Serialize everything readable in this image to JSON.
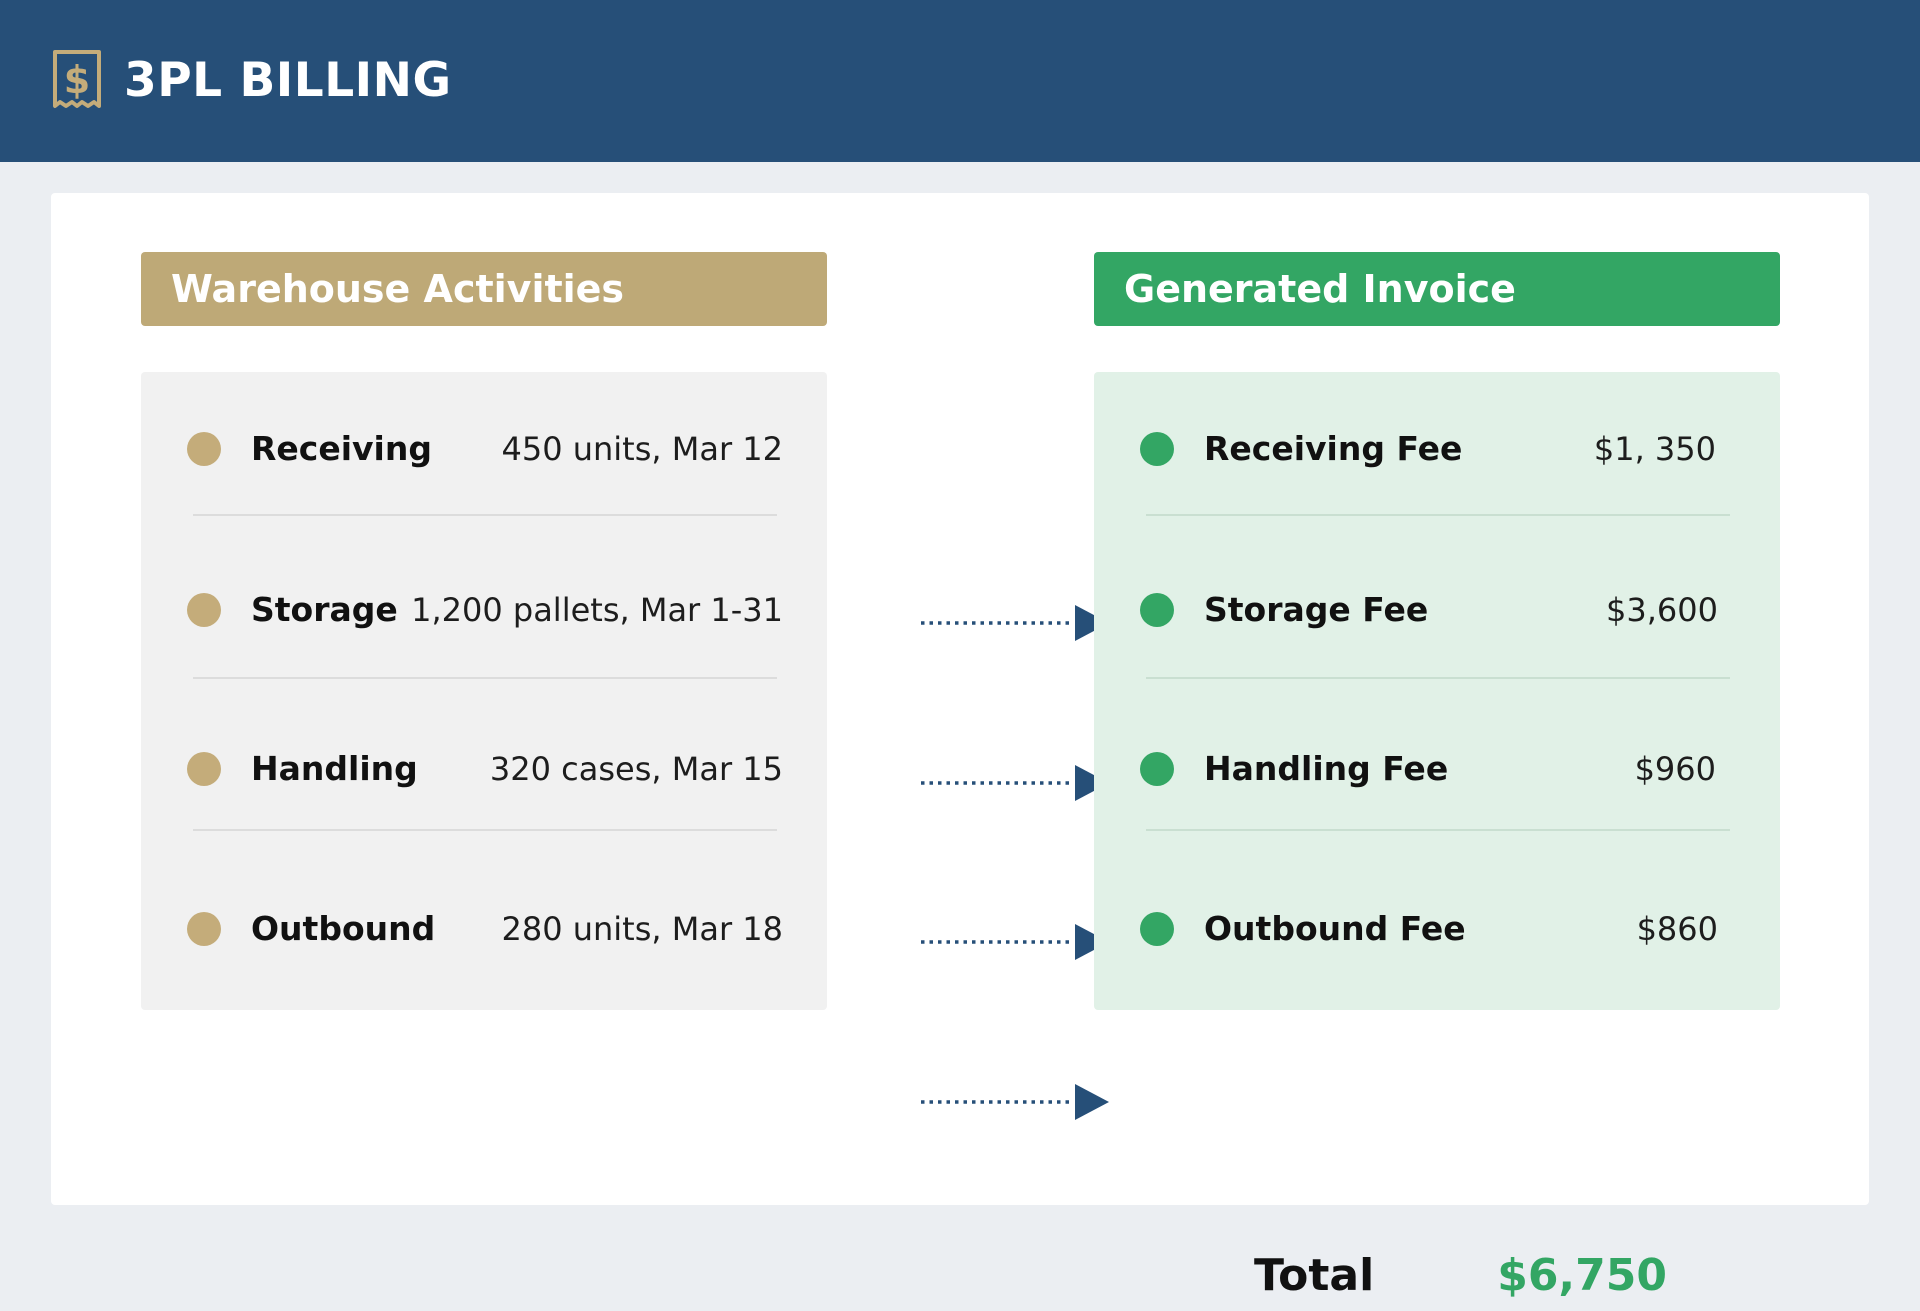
{
  "app": {
    "title": "3PL BILLING",
    "logo_icon": "receipt-dollar-icon"
  },
  "activities": {
    "title": "Warehouse Activities",
    "items": [
      {
        "label": "Receiving",
        "detail": "450 units, Mar 12"
      },
      {
        "label": "Storage",
        "detail": "1,200 pallets, Mar 1-31"
      },
      {
        "label": "Handling",
        "detail": "320 cases, Mar 15"
      },
      {
        "label": "Outbound",
        "detail": "280 units, Mar 18"
      }
    ]
  },
  "invoice": {
    "title": "Generated Invoice",
    "items": [
      {
        "label": "Receiving Fee",
        "amount": "$1, 350"
      },
      {
        "label": "Storage Fee",
        "amount": "$3,600"
      },
      {
        "label": "Handling Fee",
        "amount": "$960"
      },
      {
        "label": "Outbound Fee",
        "amount": "$860"
      }
    ],
    "total_label": "Total",
    "total_value": "$6,750"
  },
  "colors": {
    "header": "#264f78",
    "gold": "#bea977",
    "green": "#33a664",
    "arrow": "#264f78"
  }
}
